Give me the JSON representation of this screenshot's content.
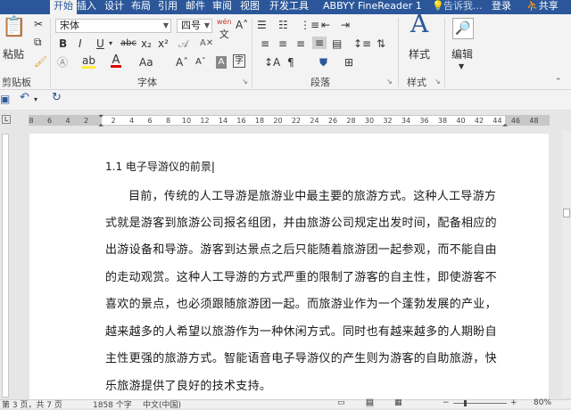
{
  "tabs": [
    {
      "label": "开始",
      "active": true
    },
    {
      "label": "插入"
    },
    {
      "label": "设计"
    },
    {
      "label": "布局"
    },
    {
      "label": "引用"
    },
    {
      "label": "邮件"
    },
    {
      "label": "审阅"
    },
    {
      "label": "视图"
    },
    {
      "label": "开发工具"
    },
    {
      "label": "ABBYY FineReader 1"
    }
  ],
  "tell_me": "告诉我...",
  "login": "登录",
  "share": "共享",
  "ribbon": {
    "clipboard": {
      "paste": "粘贴",
      "label": "剪贴板"
    },
    "font": {
      "name": "宋体",
      "size": "四号",
      "wen": "wén",
      "bold": "B",
      "italic": "I",
      "underline": "U",
      "strike": "abc",
      "subscript": "x₂",
      "superscript": "x²",
      "case": "Aa",
      "grow": "Aˆ",
      "shrink": "Aˇ",
      "label": "字体"
    },
    "paragraph": {
      "label": "段落"
    },
    "styles": {
      "title": "样式",
      "label": "样式"
    },
    "editing": {
      "title": "编辑"
    }
  },
  "ruler_numbers": [
    "8",
    "6",
    "4",
    "2",
    "2",
    "4",
    "6",
    "8",
    "10",
    "12",
    "14",
    "16",
    "18",
    "20",
    "22",
    "24",
    "26",
    "28",
    "30",
    "32",
    "34",
    "36",
    "38",
    "40",
    "42",
    "44",
    "46",
    "48"
  ],
  "document": {
    "heading": "1.1  电子导游仪的前景",
    "lines": [
      "目前，传统的人工导游是旅游业中最主要的旅游方式。这种人工导游方",
      "式就是游客到旅游公司报名组团，并由旅游公司规定出发时间，配备相应的",
      "出游设备和导游。游客到达景点之后只能随着旅游团一起参观，而不能自由",
      "的走动观赏。这种人工导游的方式严重的限制了游客的自主性，即使游客不",
      "喜欢的景点，也必须跟随旅游团一起。而旅游业作为一个蓬勃发展的产业，",
      "越来越多的人希望以旅游作为一种休闲方式。同时也有越来越多的人期盼自",
      "主性更强的旅游方式。智能语音电子导游仪的产生则为游客的自助旅游，快",
      "乐旅游提供了良好的技术支持。"
    ]
  },
  "status": {
    "page": "第 3 页，共 7 页",
    "words": "1858 个字",
    "lang": "中文(中国)",
    "zoom": "80%"
  }
}
